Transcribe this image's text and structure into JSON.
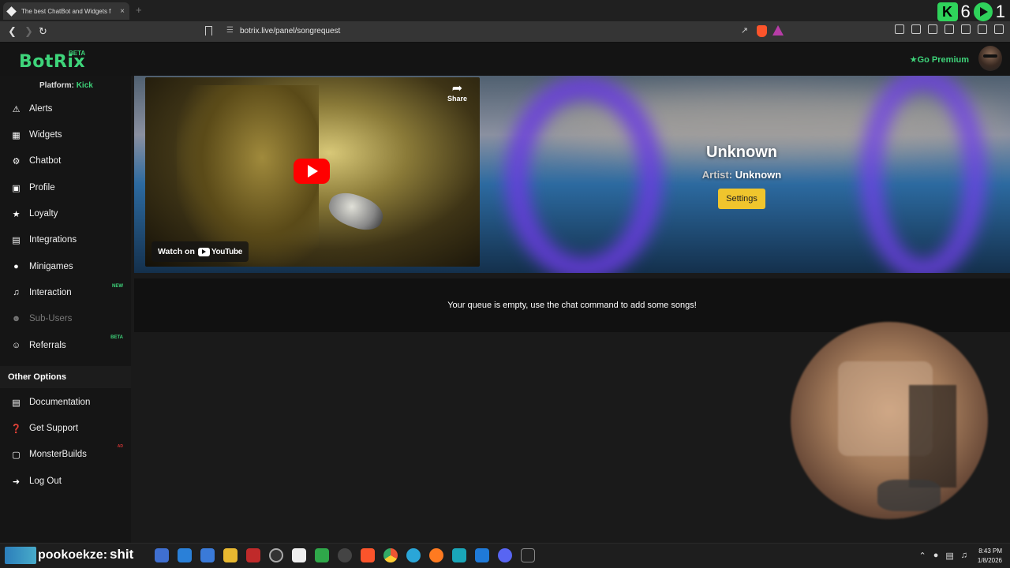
{
  "browser": {
    "tab_title": "The best ChatBot and Widgets f",
    "tab_close": "×",
    "new_tab": "+",
    "url": "botrix.live/panel/songrequest",
    "counter_a": "6",
    "counter_b": "1",
    "kick_glyph": "K"
  },
  "header": {
    "logo": "BotRix",
    "beta": "BETA",
    "premium": "Go Premium"
  },
  "sidebar": {
    "platform_label": "Platform:",
    "platform_value": "Kick",
    "items": [
      {
        "label": "Alerts",
        "icon": "warning-icon"
      },
      {
        "label": "Widgets",
        "icon": "grid-icon"
      },
      {
        "label": "Chatbot",
        "icon": "robot-icon"
      },
      {
        "label": "Profile",
        "icon": "id-card-icon"
      },
      {
        "label": "Loyalty",
        "icon": "trophy-icon"
      },
      {
        "label": "Integrations",
        "icon": "puzzle-icon"
      },
      {
        "label": "Minigames",
        "icon": "gamepad-icon"
      },
      {
        "label": "Interaction",
        "icon": "music-icon",
        "tag": "NEW"
      },
      {
        "label": "Sub-Users",
        "icon": "users-icon"
      },
      {
        "label": "Referrals",
        "icon": "user-group-icon",
        "tag": "BETA"
      }
    ],
    "other_options": "Other Options",
    "other_items": [
      {
        "label": "Documentation",
        "icon": "book-icon"
      },
      {
        "label": "Get Support",
        "icon": "question-icon"
      },
      {
        "label": "MonsterBuilds",
        "icon": "laptop-icon",
        "tag": "AD"
      },
      {
        "label": "Log Out",
        "icon": "logout-icon"
      }
    ]
  },
  "player": {
    "share": "Share",
    "watch_on": "Watch on",
    "youtube": "YouTube",
    "song_title": "Unknown",
    "artist_label": "Artist:",
    "artist_value": "Unknown",
    "settings": "Settings"
  },
  "queue": {
    "empty_message": "Your queue is empty, use the chat command to add some songs!"
  },
  "taskbar": {
    "chat_user": "pookoekze:",
    "chat_message": "shit",
    "time": "8:43 PM",
    "date": "1/8/2026"
  },
  "colors": {
    "accent": "#3ed47a",
    "settings_button": "#f0c52d",
    "youtube_red": "#ff0000"
  }
}
